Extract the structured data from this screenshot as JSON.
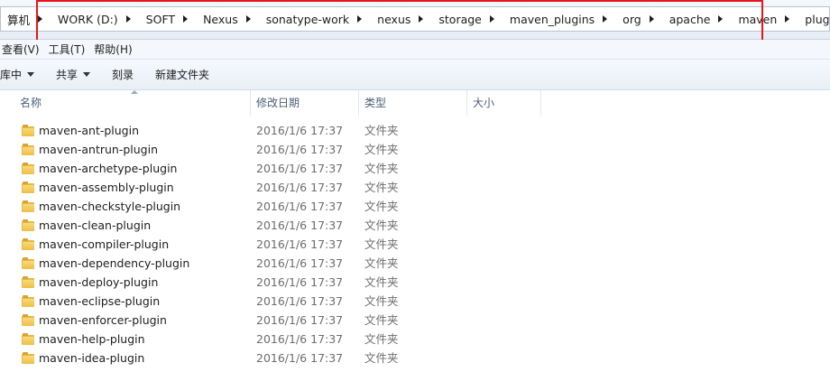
{
  "address_bar": {
    "crumbs": [
      "算机",
      "WORK (D:)",
      "SOFT",
      "Nexus",
      "sonatype-work",
      "nexus",
      "storage",
      "maven_plugins",
      "org",
      "apache",
      "maven",
      "plugins"
    ]
  },
  "menubar": {
    "items": [
      "查看(V)",
      "工具(T)",
      "帮助(H)"
    ]
  },
  "toolbar": {
    "library_label": "库中",
    "share_label": "共享",
    "burn_label": "刻录",
    "new_folder_label": "新建文件夹"
  },
  "columns": {
    "name": "名称",
    "modified": "修改日期",
    "type": "类型",
    "size": "大小"
  },
  "files": [
    {
      "name": "maven-ant-plugin",
      "modified": "2016/1/6 17:37",
      "type": "文件夹"
    },
    {
      "name": "maven-antrun-plugin",
      "modified": "2016/1/6 17:37",
      "type": "文件夹"
    },
    {
      "name": "maven-archetype-plugin",
      "modified": "2016/1/6 17:37",
      "type": "文件夹"
    },
    {
      "name": "maven-assembly-plugin",
      "modified": "2016/1/6 17:37",
      "type": "文件夹"
    },
    {
      "name": "maven-checkstyle-plugin",
      "modified": "2016/1/6 17:37",
      "type": "文件夹"
    },
    {
      "name": "maven-clean-plugin",
      "modified": "2016/1/6 17:37",
      "type": "文件夹"
    },
    {
      "name": "maven-compiler-plugin",
      "modified": "2016/1/6 17:37",
      "type": "文件夹"
    },
    {
      "name": "maven-dependency-plugin",
      "modified": "2016/1/6 17:37",
      "type": "文件夹"
    },
    {
      "name": "maven-deploy-plugin",
      "modified": "2016/1/6 17:37",
      "type": "文件夹"
    },
    {
      "name": "maven-eclipse-plugin",
      "modified": "2016/1/6 17:37",
      "type": "文件夹"
    },
    {
      "name": "maven-enforcer-plugin",
      "modified": "2016/1/6 17:37",
      "type": "文件夹"
    },
    {
      "name": "maven-help-plugin",
      "modified": "2016/1/6 17:37",
      "type": "文件夹"
    },
    {
      "name": "maven-idea-plugin",
      "modified": "2016/1/6 17:37",
      "type": "文件夹"
    }
  ],
  "colors": {
    "highlight_border": "#e8141b",
    "folder": "#efbf48"
  }
}
